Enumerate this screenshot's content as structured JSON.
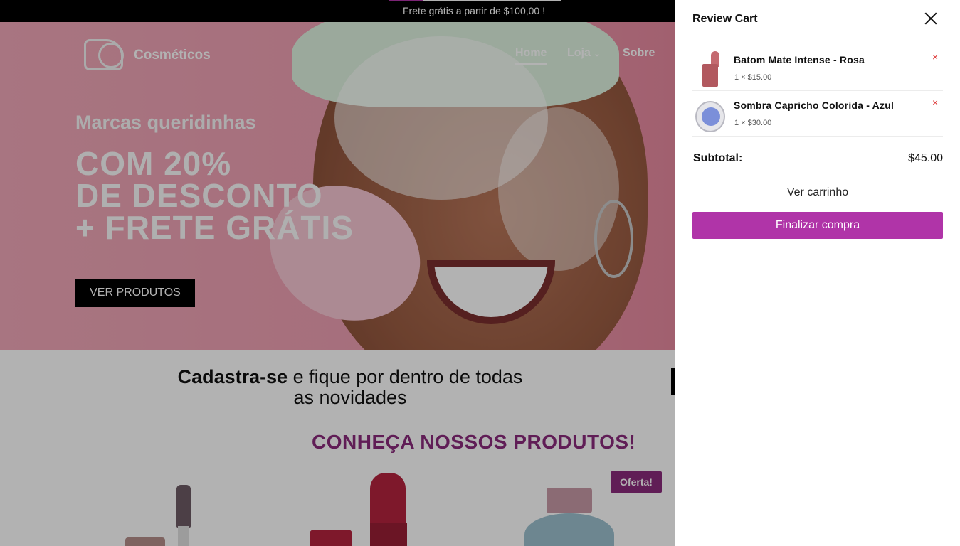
{
  "topbar": {
    "text": "Frete grátis a partir de $100,00 !"
  },
  "header": {
    "brand": "Cosméticos",
    "nav": [
      {
        "label": "Home"
      },
      {
        "label": "Loja"
      },
      {
        "label": "Sobre"
      }
    ]
  },
  "hero": {
    "subtitle": "Marcas queridinhas",
    "title_line1": "COM 20%",
    "title_line2": "DE DESCONTO",
    "title_line3": "+ FRETE GRÁTIS",
    "button_label": "VER PRODUTOS"
  },
  "newsletter": {
    "bold": "Cadastra-se",
    "rest": " e fique por dentro de todas as novidades"
  },
  "products": {
    "section_title": "CONHEÇA NOSSOS PRODUTOS!",
    "badge": "Oferta!"
  },
  "cart": {
    "title": "Review Cart",
    "items": [
      {
        "name": "Batom Mate Intense - Rosa",
        "qty_price": "1 × $15.00"
      },
      {
        "name": "Sombra Capricho Colorida - Azul",
        "qty_price": "1 × $30.00"
      }
    ],
    "remove_symbol": "×",
    "subtotal_label": "Subtotal:",
    "subtotal_value": "$45.00",
    "view_cart_label": "Ver carrinho",
    "checkout_label": "Finalizar compra"
  },
  "colors": {
    "accent": "#b034a8",
    "section_title": "#8a2a7c",
    "overlay": "rgba(0,0,0,0.3)"
  }
}
